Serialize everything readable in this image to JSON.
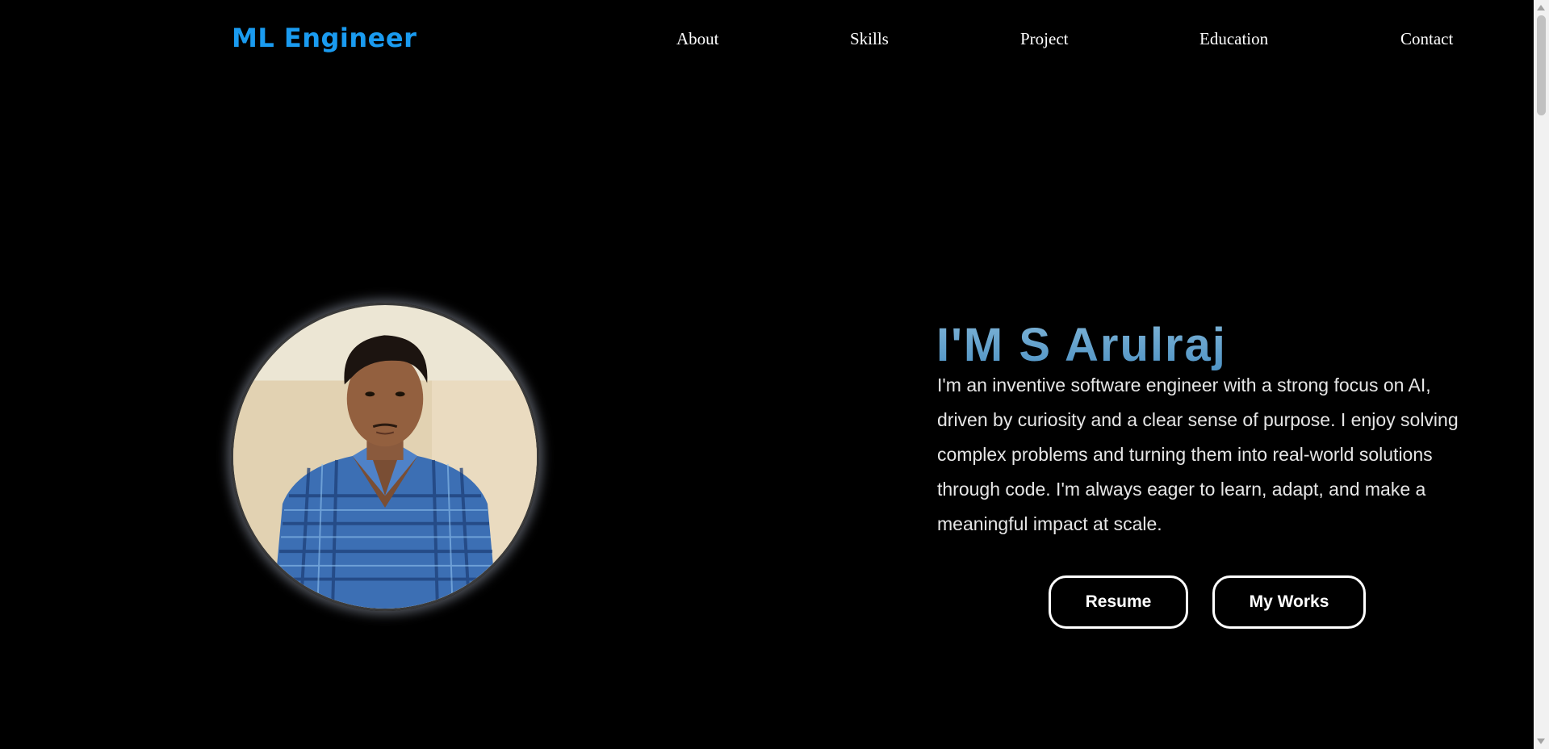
{
  "brand": "ML Engineer",
  "nav": {
    "about": "About",
    "skills": "Skills",
    "project": "Project",
    "education": "Education",
    "contact": "Contact"
  },
  "hero": {
    "title": "I'M S Arulraj",
    "description": "I'm an inventive software engineer with a strong focus on AI, driven by curiosity and a clear sense of purpose. I enjoy solving complex problems and turning them into real-world solutions through code. I'm always eager to learn, adapt, and make a meaningful impact at scale.",
    "resume_label": "Resume",
    "works_label": "My Works"
  },
  "colors": {
    "background": "#000000",
    "brand": "#1a9bf0",
    "title": "#5fa0c8",
    "text": "#e6e6e6"
  },
  "icons": {
    "portrait": "profile-photo"
  }
}
